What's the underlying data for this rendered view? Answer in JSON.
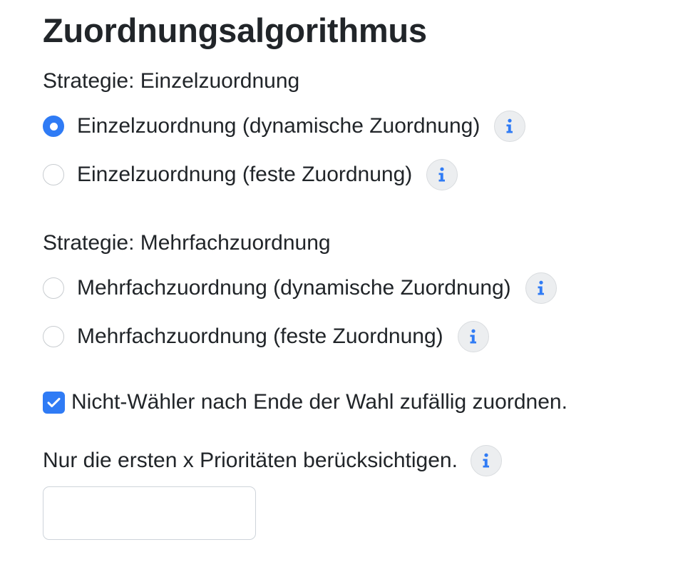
{
  "page": {
    "title": "Zuordnungsalgorithmus"
  },
  "single_strategy": {
    "title": "Strategie: Einzelzuordnung",
    "options": [
      {
        "label": "Einzelzuordnung (dynamische Zuordnung)",
        "selected": true,
        "info_icon": "info-icon"
      },
      {
        "label": "Einzelzuordnung (feste Zuordnung)",
        "selected": false,
        "info_icon": "info-icon"
      }
    ]
  },
  "multi_strategy": {
    "title": "Strategie: Mehrfachzuordnung",
    "options": [
      {
        "label": "Mehrfachzuordnung (dynamische Zuordnung)",
        "selected": false,
        "info_icon": "info-icon"
      },
      {
        "label": "Mehrfachzuordnung (feste Zuordnung)",
        "selected": false,
        "info_icon": "info-icon"
      }
    ]
  },
  "random_assign": {
    "label": "Nicht-Wähler nach Ende der Wahl zufällig zuordnen.",
    "checked": true
  },
  "priorities": {
    "label": "Nur die ersten x Prioritäten berücksichtigen.",
    "value": "",
    "placeholder": ""
  },
  "colors": {
    "accent": "#2f7bf5",
    "text": "#212529",
    "info_bg": "#eceef0"
  }
}
